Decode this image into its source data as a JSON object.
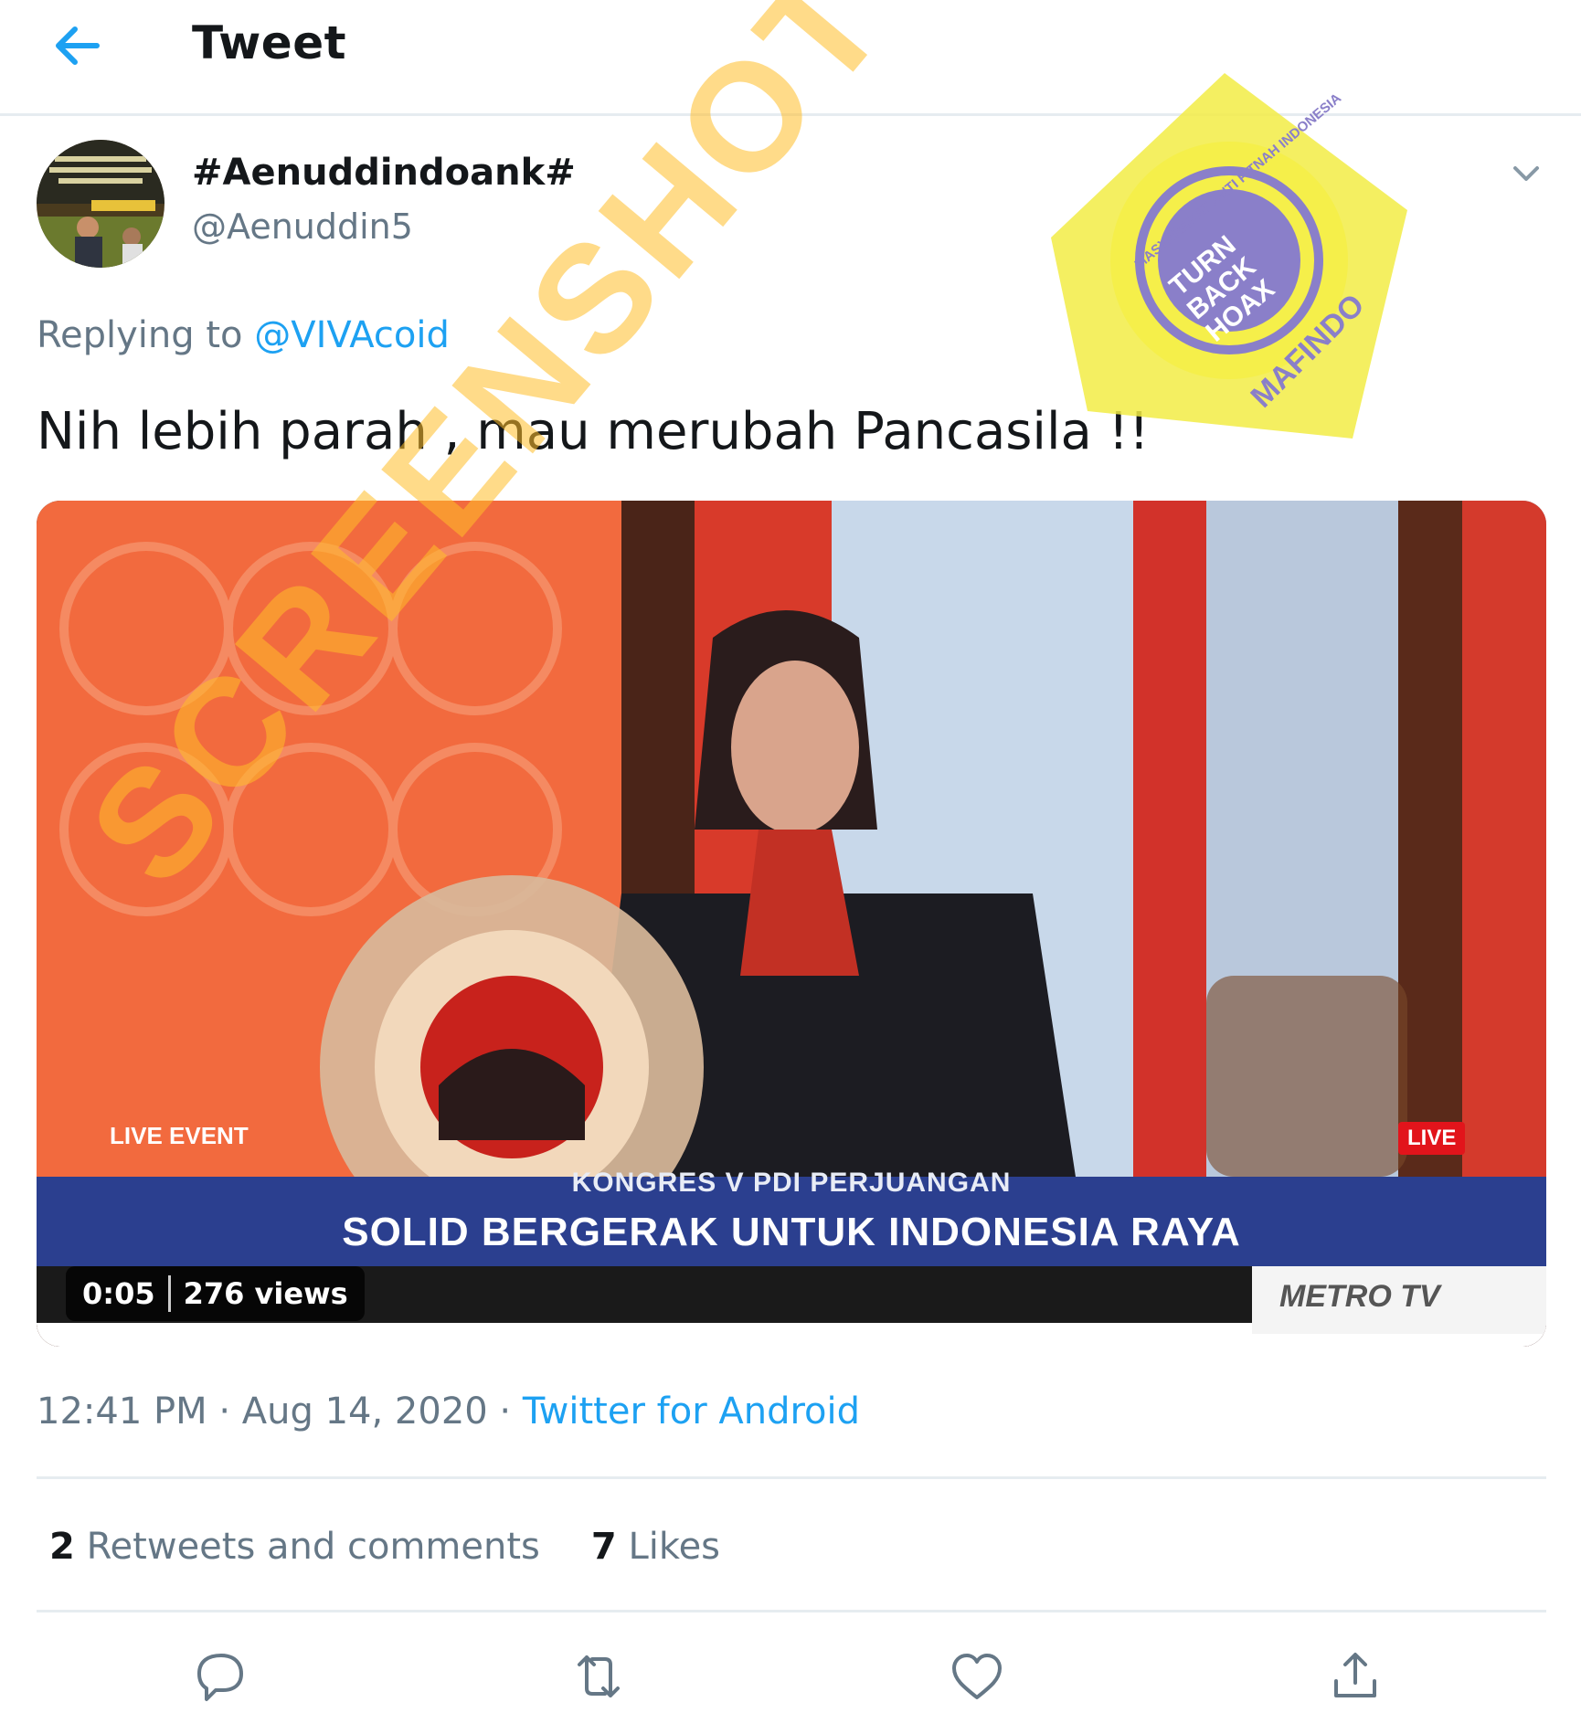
{
  "header": {
    "title": "Tweet",
    "back_icon": "arrow-left-icon"
  },
  "tweet": {
    "display_name": "#Aenuddindoank#",
    "handle": "@Aenuddin5",
    "replying_prefix": "Replying to",
    "replying_to": "@VIVAcoid",
    "text": "Nih lebih parah , mau merubah Pancasila !!",
    "timestamp": "12:41 PM · Aug 14, 2020 ·",
    "source": "Twitter for Android"
  },
  "media": {
    "duration": "0:05",
    "views": "276 views",
    "live_event_label": "LIVE EVENT",
    "live_badge": "LIVE",
    "ticker_title": "KONGRES V PDI PERJUANGAN",
    "ticker_main": "SOLID BERGERAK UNTUK INDONESIA RAYA",
    "channel_logo": "METRO TV"
  },
  "stats": {
    "retweets_count": "2",
    "retweets_label": "Retweets and comments",
    "likes_count": "7",
    "likes_label": "Likes"
  },
  "actions": [
    "reply-icon",
    "retweet-icon",
    "like-icon",
    "share-icon"
  ],
  "overlays": {
    "watermark_text": "SCREENSHOT BY",
    "stamp_center": "TURN BACK HOAX",
    "stamp_ring_top": "MASYARAKAT ANTI FITNAH INDONESIA",
    "stamp_ring_bottom": "MAFINDO"
  },
  "colors": {
    "link": "#1da1f2",
    "muted": "#657786",
    "divider": "#e6ecf0",
    "stamp_yellow": "#f2ec45",
    "stamp_purple": "#8a7fc9",
    "ticker_blue": "#2b3f8f"
  }
}
